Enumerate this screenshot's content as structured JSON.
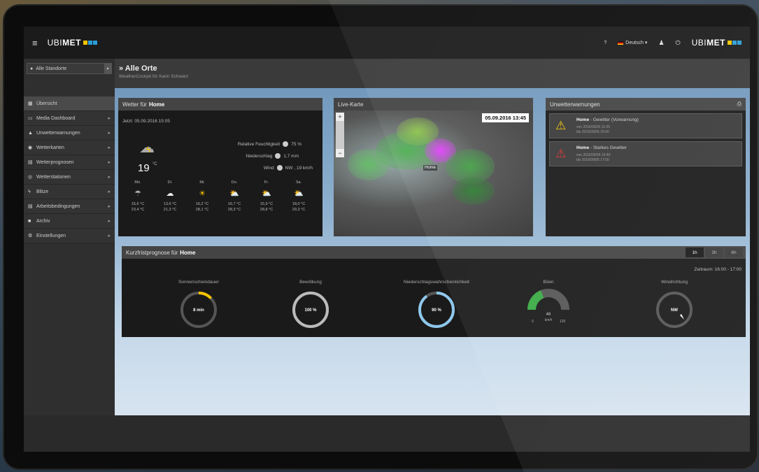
{
  "topbar": {
    "logo_prefix": "UBI",
    "logo_suffix": "MET",
    "help": "?",
    "language": "Deutsch",
    "right_logo_prefix": "UBI",
    "right_logo_suffix": "MET",
    "logo_colors": [
      "#f5c400",
      "#2a9ed8",
      "#2a9ed8"
    ]
  },
  "sidebar": {
    "location_select": "Alle Standorte",
    "items": [
      {
        "label": "Übersicht",
        "icon": "grid-icon",
        "glyph": "▦",
        "active": true
      },
      {
        "label": "Media Dashboard",
        "icon": "monitor-icon",
        "glyph": "▭",
        "active": false
      },
      {
        "label": "Unwetterwarnungen",
        "icon": "warning-icon",
        "glyph": "▲",
        "active": false
      },
      {
        "label": "Wetterkarten",
        "icon": "globe-icon",
        "glyph": "◉",
        "active": false
      },
      {
        "label": "Wetterprognosen",
        "icon": "chart-icon",
        "glyph": "▤",
        "active": false
      },
      {
        "label": "Wetterstationen",
        "icon": "station-icon",
        "glyph": "◎",
        "active": false
      },
      {
        "label": "Blitze",
        "icon": "lightning-icon",
        "glyph": "ϟ",
        "active": false
      },
      {
        "label": "Arbeitsbedingungen",
        "icon": "list-icon",
        "glyph": "▤",
        "active": false
      },
      {
        "label": "Archiv",
        "icon": "archive-icon",
        "glyph": "■",
        "active": false
      },
      {
        "label": "Einstellungen",
        "icon": "settings-icon",
        "glyph": "⚙",
        "active": false
      }
    ]
  },
  "header": {
    "title": "Alle Orte",
    "subtitle": "WeatherCockpit für Karin Schwarz"
  },
  "weather": {
    "title_prefix": "Wetter für",
    "location": "Home",
    "time": "Jetzt: 05.09.2016 15:05",
    "temp": "19",
    "unit": "°C",
    "humidity_label": "Relative Feuchtigkeit",
    "humidity_value": "75 %",
    "precip_label": "Niederschlag",
    "precip_value": "1,7 mm",
    "wind_label": "Wind",
    "wind_value": "NW , 19 km/h",
    "forecast": [
      {
        "day": "Mo.",
        "icon": "rain-icon",
        "glyph": "☂",
        "color": "#aaaaaa",
        "min": "15,6 °C",
        "max": "23,4 °C"
      },
      {
        "day": "Di.",
        "icon": "snow-cloud-icon",
        "glyph": "☁",
        "color": "#eeeeee",
        "min": "13,6 °C",
        "max": "21,3 °C"
      },
      {
        "day": "Mi.",
        "icon": "sun-icon",
        "glyph": "☀",
        "color": "#f5c400",
        "min": "16,2 °C",
        "max": "28,1 °C"
      },
      {
        "day": "Do.",
        "icon": "partly-cloudy-icon",
        "glyph": "⛅",
        "color": "#f5c400",
        "min": "16,7 °C",
        "max": "28,3 °C"
      },
      {
        "day": "Fr.",
        "icon": "partly-cloudy-icon",
        "glyph": "⛅",
        "color": "#f5c400",
        "min": "15,9 °C",
        "max": "28,8 °C"
      },
      {
        "day": "Sa.",
        "icon": "partly-cloudy-icon",
        "glyph": "⛅",
        "color": "#f5c400",
        "min": "18,0 °C",
        "max": "29,3 °C"
      }
    ]
  },
  "livemap": {
    "title": "Live-Karte",
    "timestamp": "05.09.2016 13:45",
    "home_label": "Home",
    "zoom_in": "+",
    "zoom_out": "−"
  },
  "warnings": {
    "title": "Unwetterwarnungen",
    "items": [
      {
        "location": "Home",
        "text": " - Gewitter (Vorwarnung)",
        "from": "von 2016/09/05 11:00",
        "to": "bis 2016/09/05 20:00",
        "color": "#f5c400"
      },
      {
        "location": "Home",
        "text": " - Starkes Gewitter",
        "from": "von 2016/09/05 13:40",
        "to": "bis 2016/09/05 17:00",
        "color": "#e03030"
      }
    ]
  },
  "nowcast": {
    "title_prefix": "Kurzfristprognose für",
    "location": "Home",
    "tabs": [
      "1h",
      "3h",
      "6h"
    ],
    "active_tab": 0,
    "period": "Zeitraum: 16:00 - 17:00",
    "gauges": [
      {
        "label": "Sonnenscheindauer",
        "value": "8 min",
        "fraction": 0.13,
        "color": "#f5c400"
      },
      {
        "label": "Bewölkung",
        "value": "100 %",
        "fraction": 1.0,
        "color": "#bbbbbb"
      },
      {
        "label": "Niederschlagswahrscheinlichkeit",
        "value": "90 %",
        "fraction": 0.9,
        "color": "#8ec8ec"
      },
      {
        "label": "Böen",
        "value": "46",
        "unit": "km/h",
        "min": "0",
        "max": "120",
        "fraction": 0.38,
        "color": "#3aaa44"
      },
      {
        "label": "Windrichtung",
        "value": "NW"
      }
    ]
  }
}
